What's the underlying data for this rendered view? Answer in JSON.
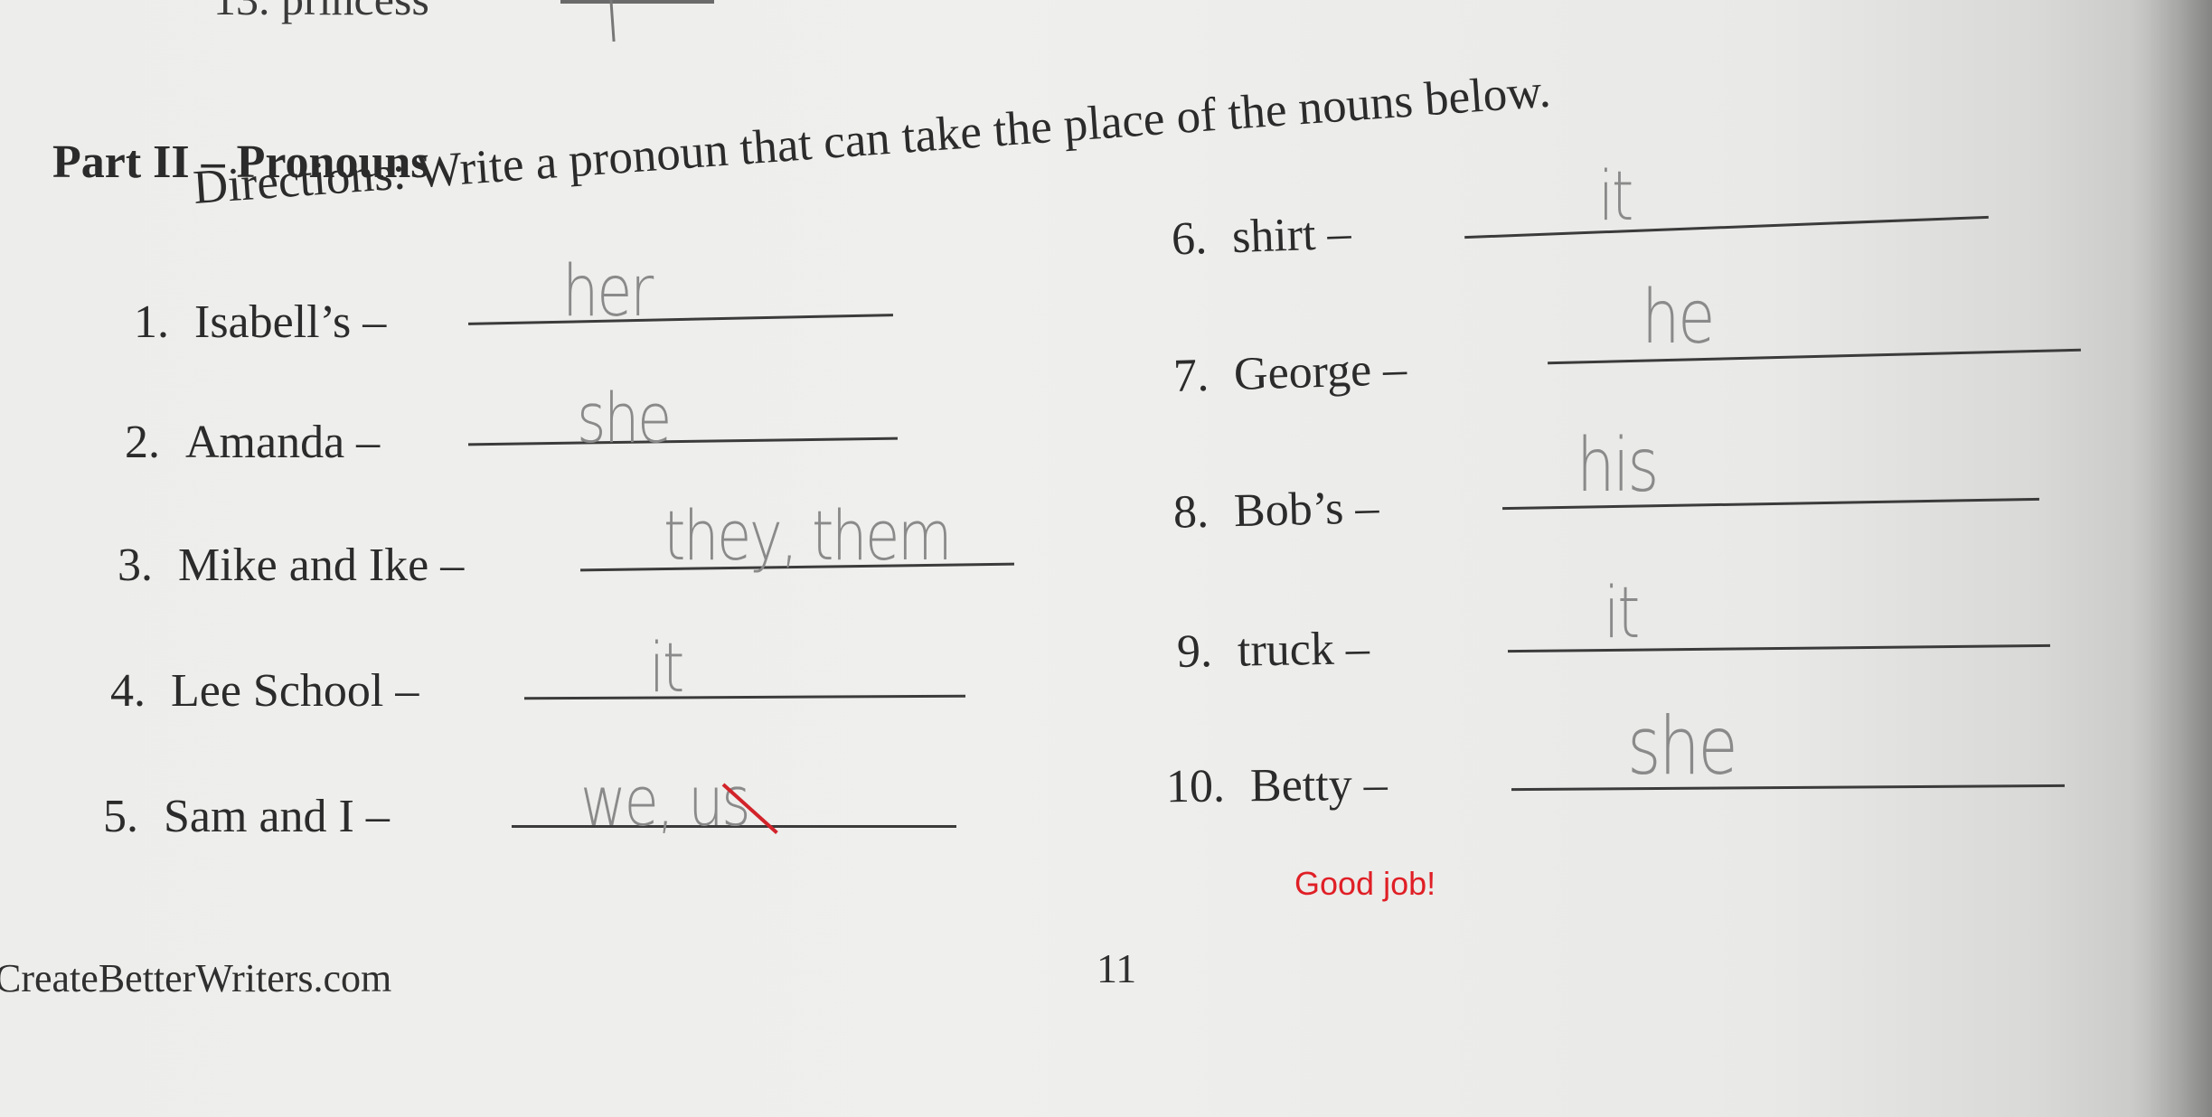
{
  "previous_item": {
    "text": "13. princess"
  },
  "section": {
    "title": "Part II – Pronouns",
    "directions": "Directions:  Write a pronoun that can take the place of the nouns below."
  },
  "items": [
    {
      "number": "1.",
      "noun": "Isabell’s –",
      "answer": "her"
    },
    {
      "number": "2.",
      "noun": "Amanda –",
      "answer": "she"
    },
    {
      "number": "3.",
      "noun": "Mike and Ike –",
      "answer": "they, them"
    },
    {
      "number": "4.",
      "noun": "Lee School –",
      "answer": "it"
    },
    {
      "number": "5.",
      "noun": "Sam and I –",
      "answer": "we, us",
      "corrected_word": "us"
    },
    {
      "number": "6.",
      "noun": "shirt –",
      "answer": "it"
    },
    {
      "number": "7.",
      "noun": "George –",
      "answer": "he"
    },
    {
      "number": "8.",
      "noun": "Bob’s –",
      "answer": "his"
    },
    {
      "number": "9.",
      "noun": "truck –",
      "answer": "it"
    },
    {
      "number": "10.",
      "noun": "Betty –",
      "answer": "she"
    }
  ],
  "feedback": "Good job!",
  "footer": {
    "site": "CreateBetterWriters.com",
    "page_number": "11"
  },
  "colors": {
    "paper": "#efefed",
    "print": "#2b2b2b",
    "pencil": "#8a8a8a",
    "teacher_red": "#e01f26"
  }
}
